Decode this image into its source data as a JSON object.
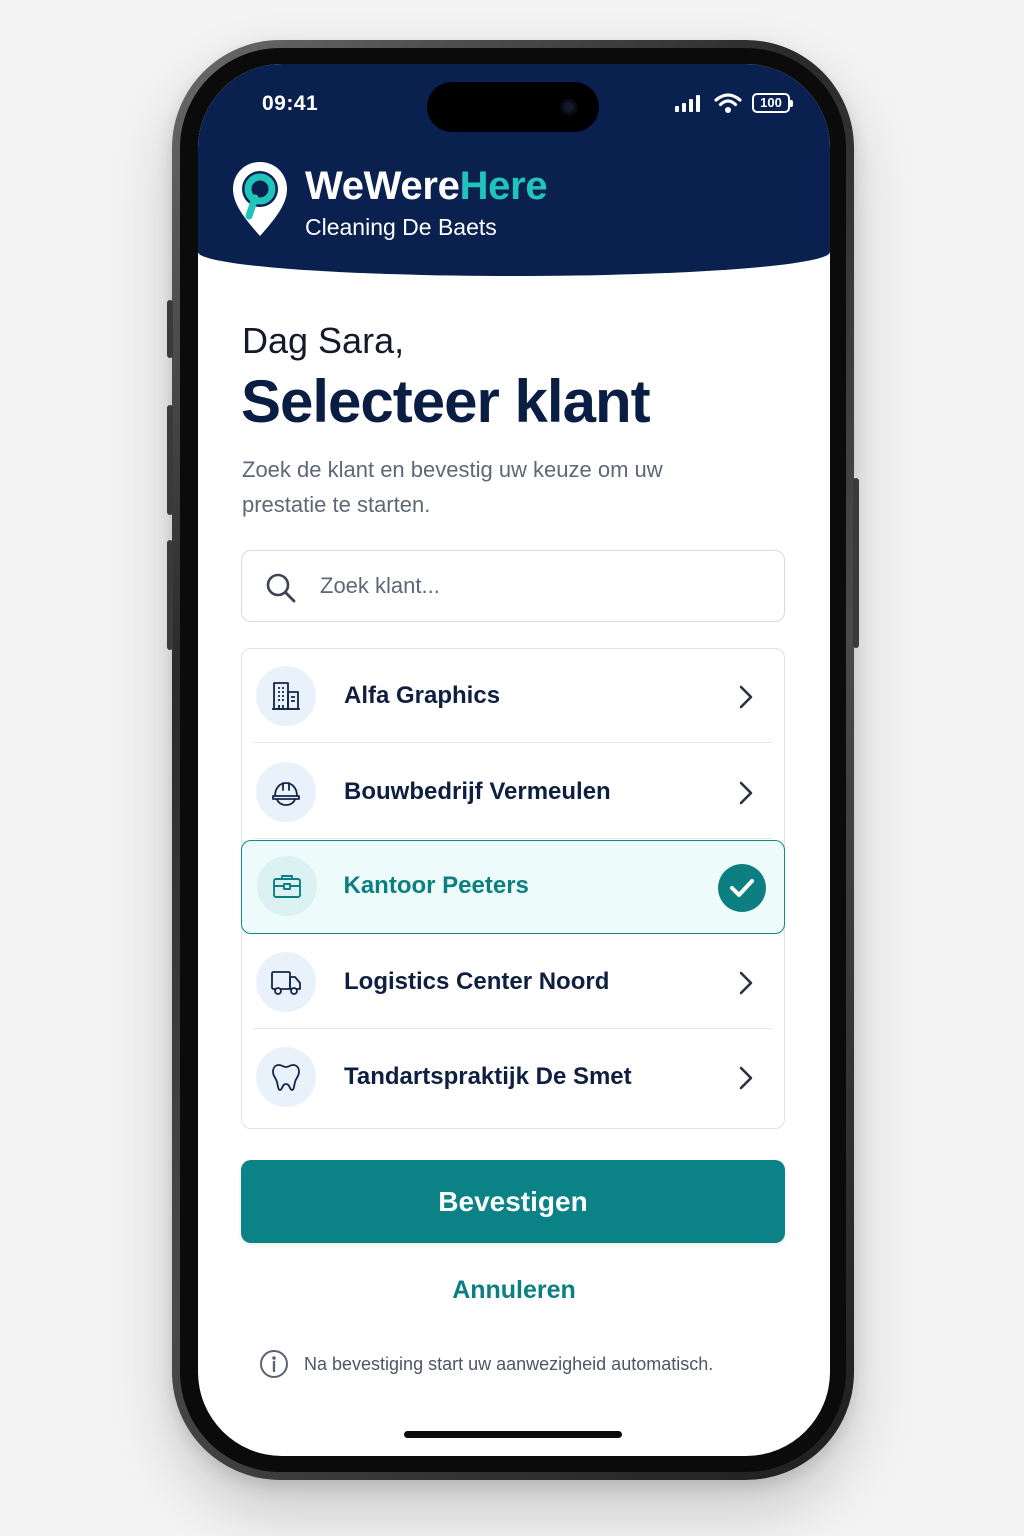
{
  "status_bar": {
    "time": "09:41",
    "battery": "100"
  },
  "app": {
    "brand_part1": "WeWere",
    "brand_part2": "Here",
    "company": "Cleaning De Baets"
  },
  "greeting": "Dag Sara,",
  "title": "Selecteer klant",
  "description": "Zoek de klant en bevestig uw keuze om uw prestatie te starten.",
  "search": {
    "placeholder": "Zoek klant...",
    "value": ""
  },
  "clients": [
    {
      "name": "Alfa Graphics",
      "icon": "office-building-icon",
      "selected": false
    },
    {
      "name": "Bouwbedrijf Vermeulen",
      "icon": "hard-hat-icon",
      "selected": false
    },
    {
      "name": "Kantoor Peeters",
      "icon": "briefcase-icon",
      "selected": true
    },
    {
      "name": "Logistics Center Noord",
      "icon": "truck-icon",
      "selected": false
    },
    {
      "name": "Tandartspraktijk De Smet",
      "icon": "tooth-icon",
      "selected": false
    }
  ],
  "actions": {
    "confirm": "Bevestigen",
    "cancel": "Annuleren"
  },
  "info_text": "Na bevestiging start uw aanwezigheid automatisch.",
  "colors": {
    "navy": "#0a2150",
    "teal": "#0b8285",
    "brand_accent": "#21c4bb",
    "selected_bg": "#edfbfb"
  }
}
